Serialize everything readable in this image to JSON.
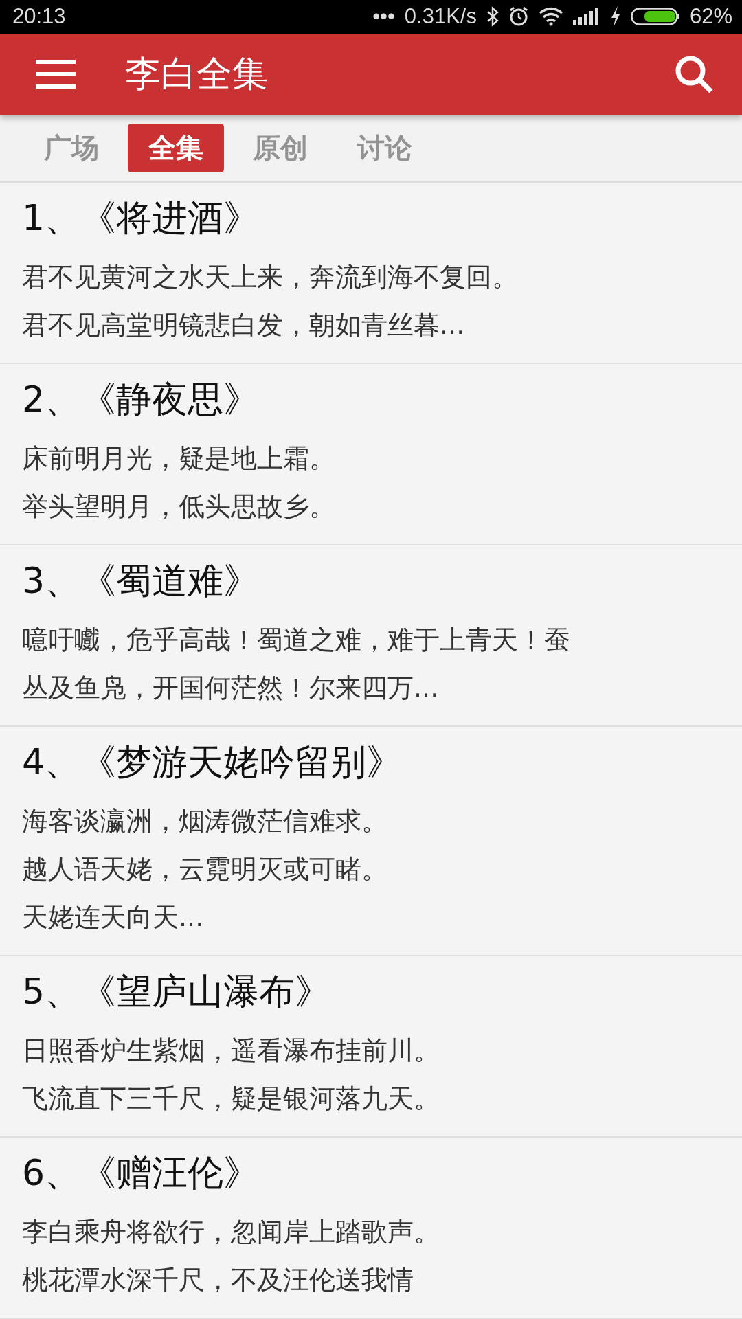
{
  "status_bar": {
    "time": "20:13",
    "dots": "•••",
    "speed": "0.31K/s",
    "battery": "62%"
  },
  "app_bar": {
    "title": "李白全集"
  },
  "tabs": [
    {
      "label": "广场",
      "selected": false
    },
    {
      "label": "全集",
      "selected": true
    },
    {
      "label": "原创",
      "selected": false
    },
    {
      "label": "讨论",
      "selected": false
    }
  ],
  "poems": [
    {
      "title": "1、《将进酒》",
      "lines": [
        "君不见黄河之水天上来，奔流到海不复回。",
        "君不见高堂明镜悲白发，朝如青丝暮..."
      ]
    },
    {
      "title": "2、《静夜思》",
      "lines": [
        "床前明月光，疑是地上霜。",
        "举头望明月，低头思故乡。"
      ]
    },
    {
      "title": "3、《蜀道难》",
      "lines": [
        "噫吁嚱，危乎高哉！蜀道之难，难于上青天！蚕",
        "丛及鱼凫，开国何茫然！尔来四万..."
      ]
    },
    {
      "title": "4、《梦游天姥吟留别》",
      "lines": [
        "海客谈瀛洲，烟涛微茫信难求。",
        "越人语天姥，云霓明灭或可睹。",
        "天姥连天向天..."
      ]
    },
    {
      "title": "5、《望庐山瀑布》",
      "lines": [
        "日照香炉生紫烟，遥看瀑布挂前川。",
        "飞流直下三千尺，疑是银河落九天。"
      ]
    },
    {
      "title": "6、《赠汪伦》",
      "lines": [
        "李白乘舟将欲行，忽闻岸上踏歌声。",
        "桃花潭水深千尺，不及汪伦送我情"
      ]
    }
  ]
}
